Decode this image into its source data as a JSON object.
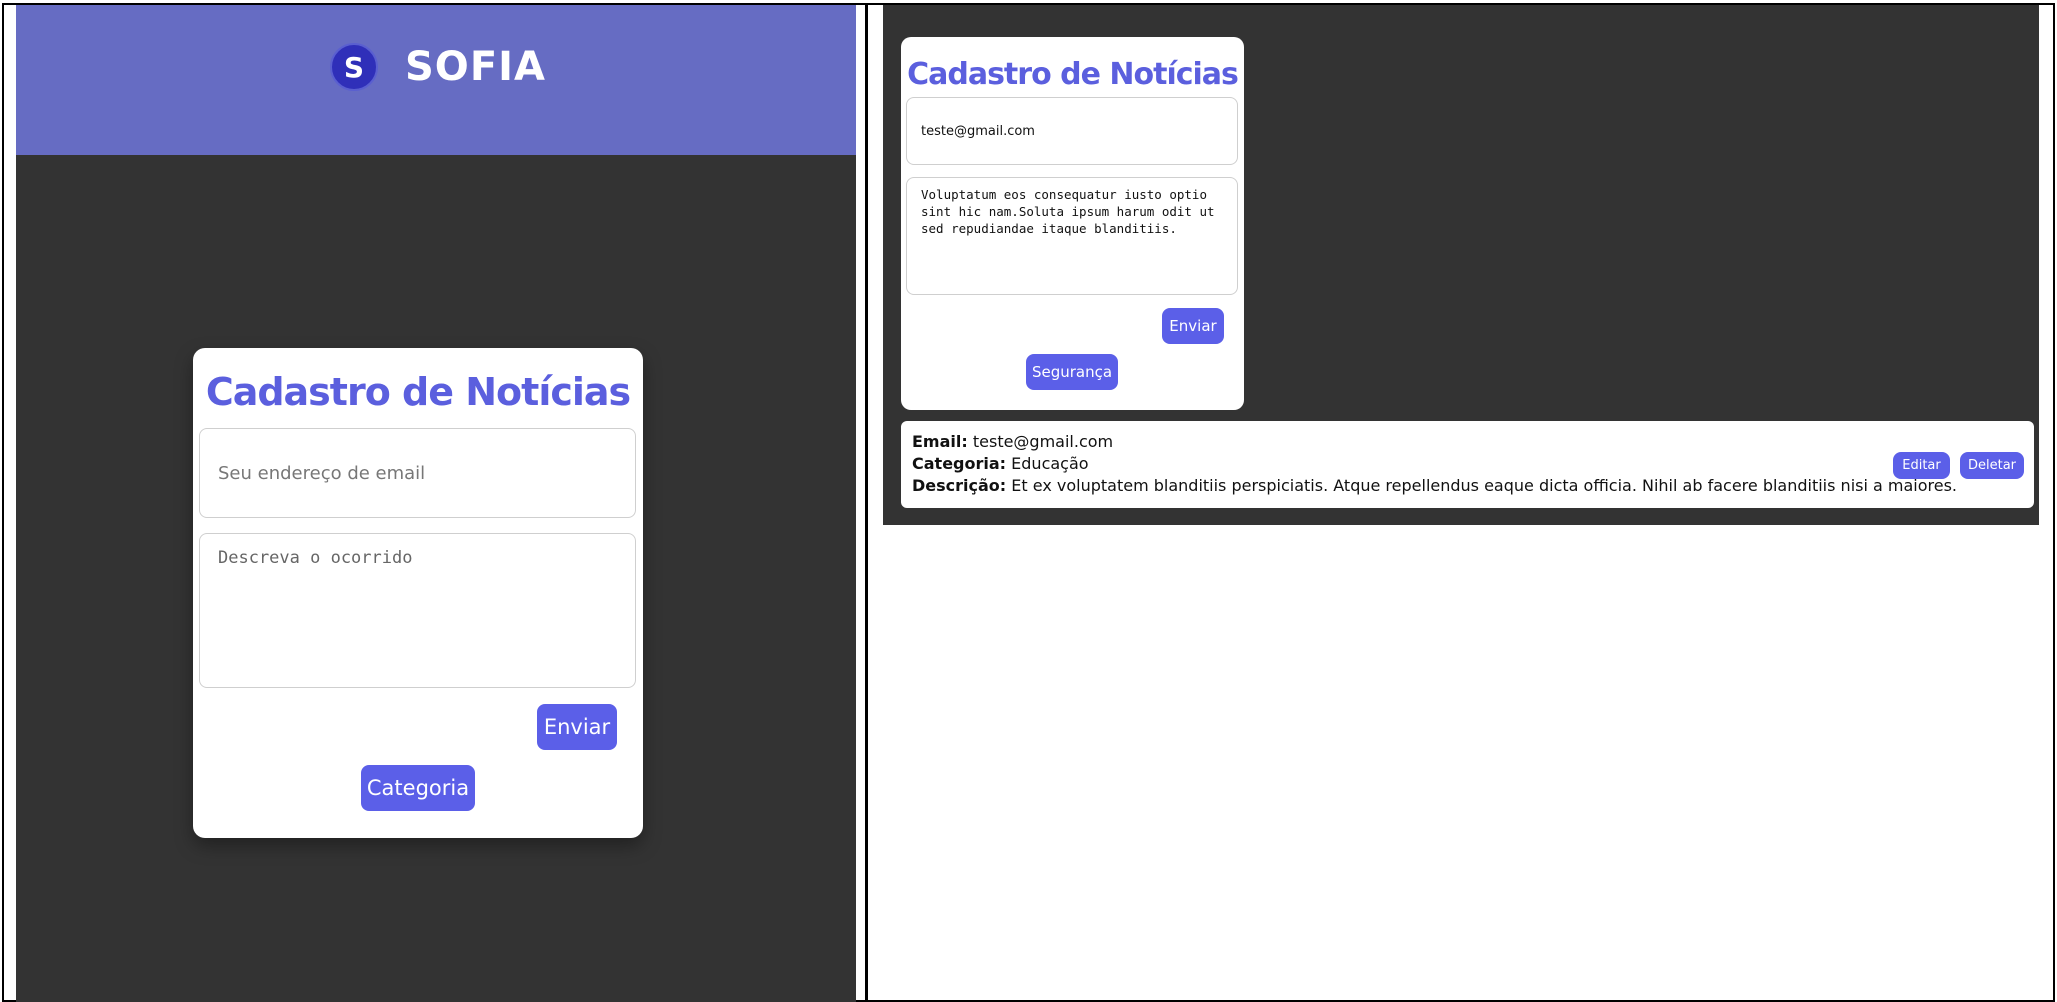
{
  "left": {
    "brand": {
      "logo_letter": "S",
      "name": "SOFIA"
    },
    "form": {
      "title": "Cadastro de Notícias",
      "email_placeholder": "Seu endereço de email",
      "description_placeholder": "Descreva o ocorrido",
      "submit_label": "Enviar",
      "category_label": "Categoria"
    }
  },
  "right": {
    "form": {
      "title": "Cadastro de Notícias",
      "email_value": "teste@gmail.com",
      "description_value": "Voluptatum eos consequatur iusto optio sint hic nam.Soluta ipsum harum odit ut sed repudiandae itaque blanditiis.",
      "submit_label": "Enviar",
      "category_label": "Segurança"
    },
    "entry": {
      "email_label": "Email:",
      "email": "teste@gmail.com",
      "category_label": "Categoria:",
      "category": "Educação",
      "description_label": "Descrição:",
      "description": "Et ex voluptatem blanditiis perspiciatis. Atque repellendus eaque dicta officia. Nihil ab facere blanditiis nisi a maiores.",
      "edit_label": "Editar",
      "delete_label": "Deletar"
    }
  },
  "colors": {
    "header": "#666cc3",
    "accent": "#5b5fe8",
    "title": "#5b5fde",
    "background": "#333333"
  }
}
